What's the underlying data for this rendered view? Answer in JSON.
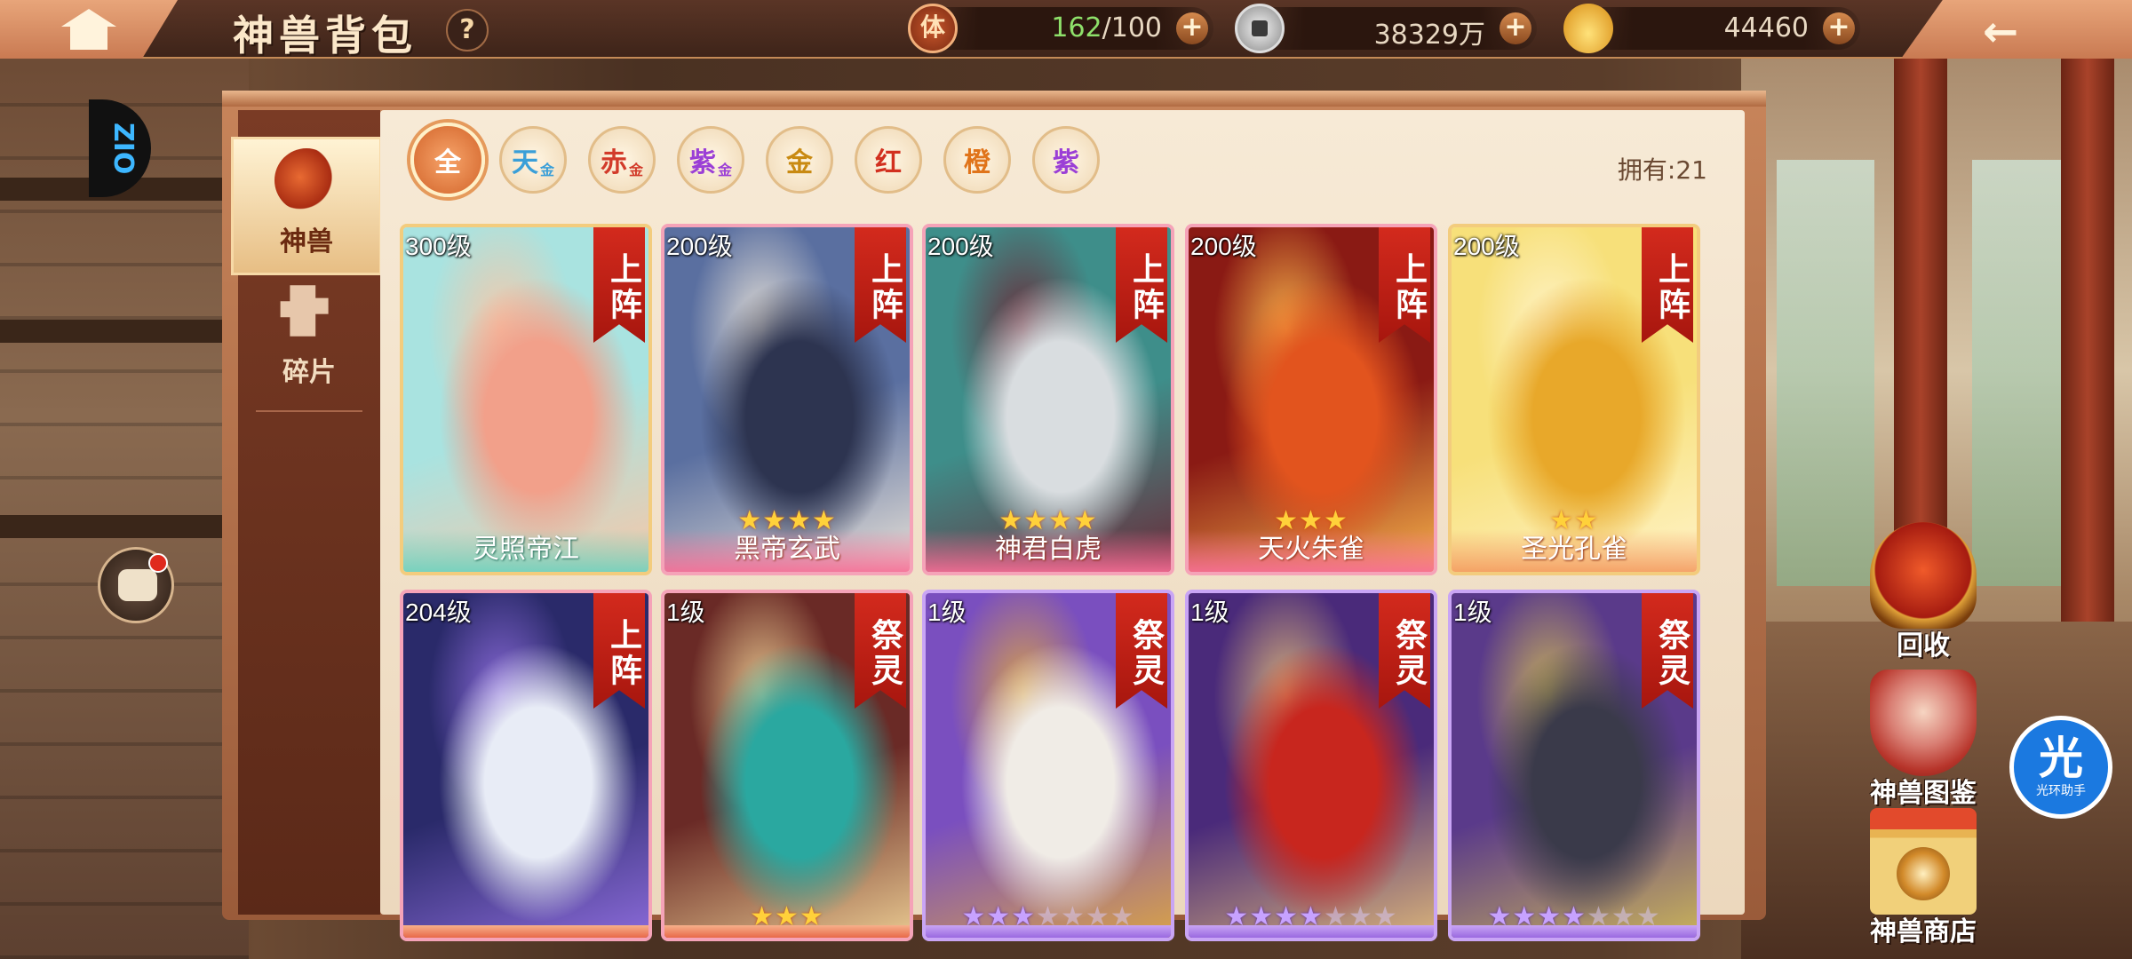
{
  "header": {
    "title": "神兽背包",
    "help_label": "?",
    "back_label": "←"
  },
  "resources": {
    "stamina": {
      "icon": "stamina-icon",
      "icon_label": "体",
      "current": "162",
      "max": "/100"
    },
    "silver": {
      "icon": "silver-coin-icon",
      "value": "38329万"
    },
    "gold": {
      "icon": "gold-ingot-icon",
      "value": "44460"
    },
    "plus_label": "+"
  },
  "side_tabs": [
    {
      "label": "神兽",
      "icon": "phoenix-icon",
      "active": true
    },
    {
      "label": "碎片",
      "icon": "puzzle-piece-icon",
      "active": false
    }
  ],
  "filters": [
    {
      "label": "全",
      "sub": "",
      "color": "#ffffff",
      "active": true
    },
    {
      "label": "天",
      "sub": "金",
      "color": "#3a9fd8",
      "active": false
    },
    {
      "label": "赤",
      "sub": "金",
      "color": "#d23b2a",
      "active": false
    },
    {
      "label": "紫",
      "sub": "金",
      "color": "#9b3fd6",
      "active": false
    },
    {
      "label": "金",
      "sub": "",
      "color": "#c98a12",
      "active": false
    },
    {
      "label": "红",
      "sub": "",
      "color": "#d2301f",
      "active": false
    },
    {
      "label": "橙",
      "sub": "",
      "color": "#e0741a",
      "active": false
    },
    {
      "label": "紫",
      "sub": "",
      "color": "#9b3fd6",
      "active": false
    }
  ],
  "owned_text": "拥有:21",
  "cards": [
    {
      "level": "300级",
      "tag": "上阵",
      "name": "灵照帝江",
      "stars": 0,
      "max_stars": 0,
      "star_color": "gold",
      "theme": "teal",
      "colors": [
        "#a9e3e0",
        "#f2a08a",
        "#f7c7a8"
      ]
    },
    {
      "level": "200级",
      "tag": "上阵",
      "name": "黑帝玄武",
      "stars": 4,
      "max_stars": 4,
      "star_color": "gold",
      "theme": "pink",
      "colors": [
        "#5a6fa0",
        "#2d3450",
        "#e8e2d8"
      ]
    },
    {
      "level": "200级",
      "tag": "上阵",
      "name": "神君白虎",
      "stars": 4,
      "max_stars": 4,
      "star_color": "gold",
      "theme": "pink",
      "colors": [
        "#3e8e8a",
        "#d9dde0",
        "#6b2a38"
      ]
    },
    {
      "level": "200级",
      "tag": "上阵",
      "name": "天火朱雀",
      "stars": 3,
      "max_stars": 3,
      "star_color": "gold",
      "theme": "pink",
      "colors": [
        "#8a1a14",
        "#e2541e",
        "#f6b24a"
      ]
    },
    {
      "level": "200级",
      "tag": "上阵",
      "name": "圣光孔雀",
      "stars": 2,
      "max_stars": 2,
      "star_color": "gold",
      "theme": "gold",
      "colors": [
        "#f7e07a",
        "#e8a82a",
        "#fff3c8"
      ]
    },
    {
      "level": "204级",
      "tag": "上阵",
      "name": "",
      "stars": 0,
      "max_stars": 0,
      "star_color": "gold",
      "theme": "pink",
      "colors": [
        "#2a2a6a",
        "#e8ecf6",
        "#8a6ad8"
      ]
    },
    {
      "level": "1级",
      "tag": "祭灵",
      "name": "",
      "stars": 3,
      "max_stars": 3,
      "star_color": "gold",
      "theme": "pink",
      "colors": [
        "#6a2a26",
        "#2aa8a0",
        "#e8c890"
      ]
    },
    {
      "level": "1级",
      "tag": "祭灵",
      "name": "",
      "stars": 3,
      "max_stars": 7,
      "star_color": "purple",
      "theme": "purple",
      "colors": [
        "#7a4fbf",
        "#f0ece6",
        "#d8a248"
      ]
    },
    {
      "level": "1级",
      "tag": "祭灵",
      "name": "",
      "stars": 4,
      "max_stars": 7,
      "star_color": "purple",
      "theme": "purple",
      "colors": [
        "#4a2a7a",
        "#c8261e",
        "#d8b27a"
      ]
    },
    {
      "level": "1级",
      "tag": "祭灵",
      "name": "",
      "stars": 4,
      "max_stars": 7,
      "star_color": "purple",
      "theme": "purple",
      "colors": [
        "#5a3a8a",
        "#3a3a4a",
        "#c9b25a"
      ]
    }
  ],
  "actions": [
    {
      "label": "回收",
      "icon": "recycle-emblem-icon"
    },
    {
      "label": "神兽图鉴",
      "icon": "codex-emblem-icon"
    },
    {
      "label": "神兽商店",
      "icon": "shop-emblem-icon"
    }
  ],
  "helper": {
    "big": "光",
    "small": "光环助手"
  },
  "side_logo_text": "ZIO"
}
